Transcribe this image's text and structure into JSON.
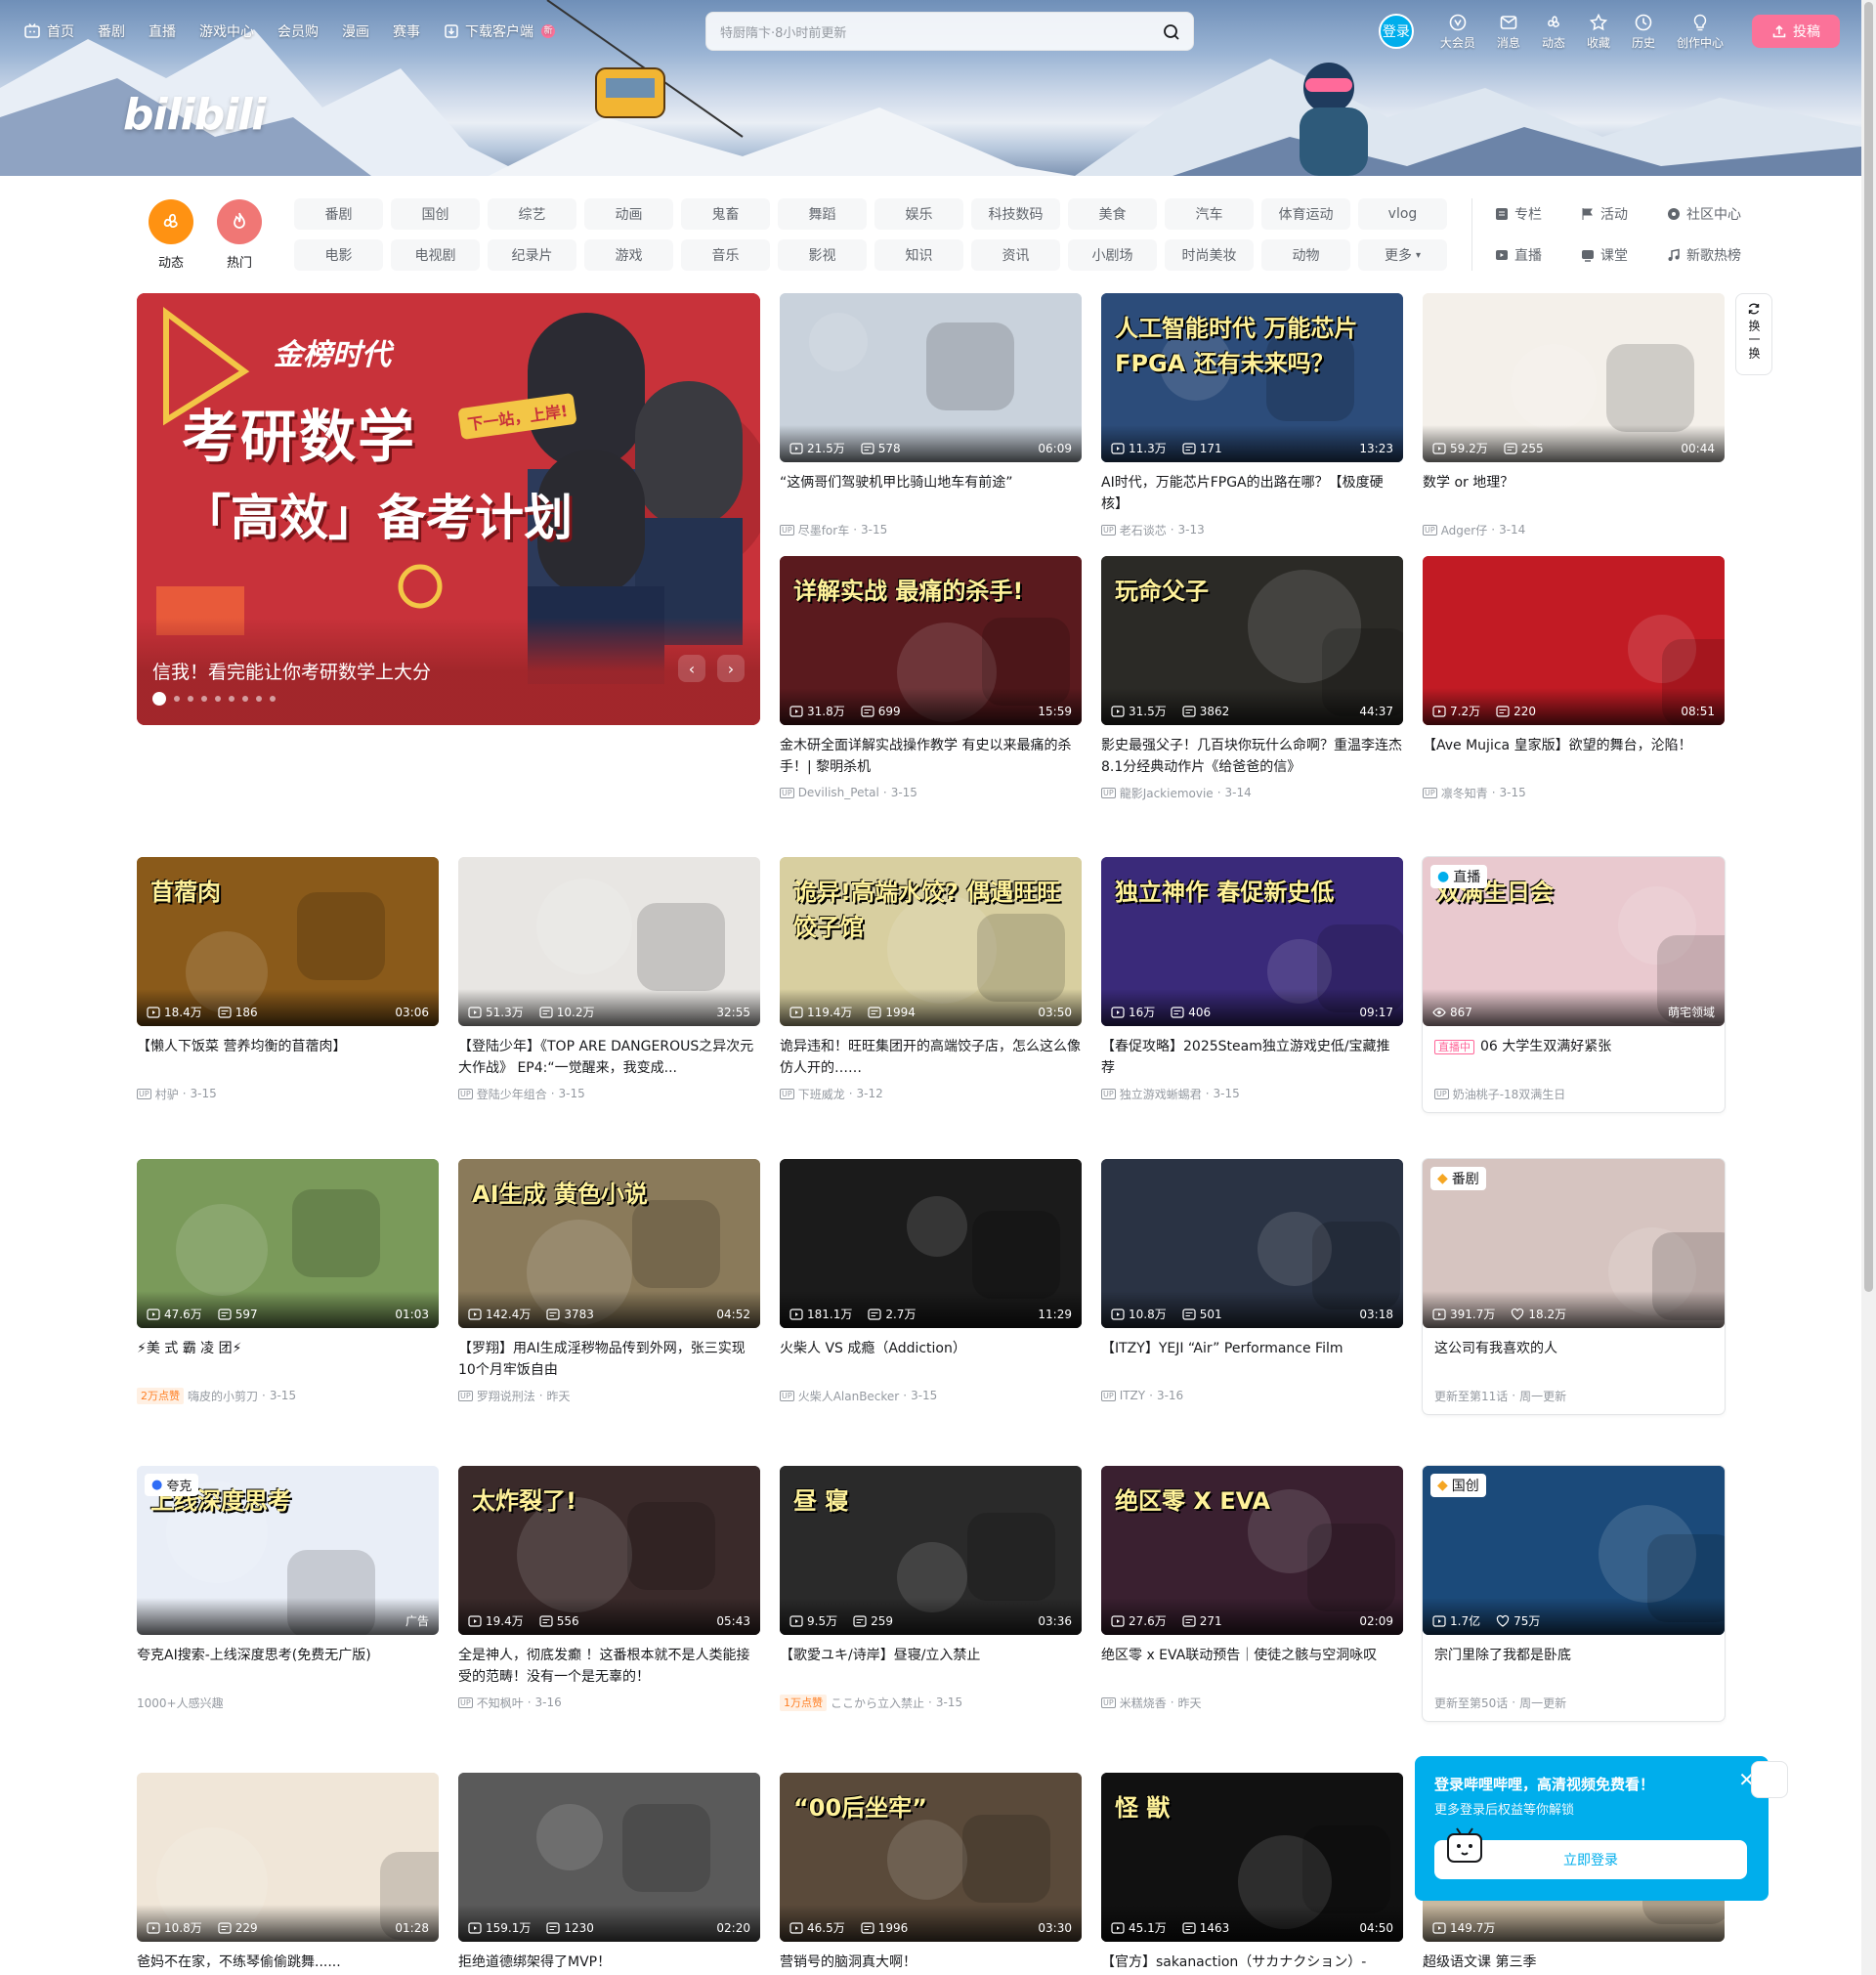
{
  "header": {
    "nav": [
      "首页",
      "番剧",
      "直播",
      "游戏中心",
      "会员购",
      "漫画",
      "赛事",
      "下载客户端"
    ],
    "new_badge": "新",
    "search_placeholder": "特厨隋卞·8小时前更新",
    "login": "登录",
    "right_items": [
      {
        "label": "大会员",
        "icon": "vip-icon"
      },
      {
        "label": "消息",
        "icon": "message-icon"
      },
      {
        "label": "动态",
        "icon": "dynamic-icon"
      },
      {
        "label": "收藏",
        "icon": "favorite-icon"
      },
      {
        "label": "历史",
        "icon": "history-icon"
      },
      {
        "label": "创作中心",
        "icon": "creator-icon"
      }
    ],
    "upload": "投稿",
    "logo": "bilibili"
  },
  "channels": {
    "icons": [
      {
        "label": "动态",
        "color": "#ff9212"
      },
      {
        "label": "热门",
        "color": "#f07775"
      }
    ],
    "tags": [
      "番剧",
      "国创",
      "综艺",
      "动画",
      "鬼畜",
      "舞蹈",
      "娱乐",
      "科技数码",
      "美食",
      "汽车",
      "体育运动",
      "vlog",
      "电影",
      "电视剧",
      "纪录片",
      "游戏",
      "音乐",
      "影视",
      "知识",
      "资讯",
      "小剧场",
      "时尚美妆",
      "动物",
      "更多"
    ],
    "extra": [
      "专栏",
      "活动",
      "社区中心",
      "直播",
      "课堂",
      "新歌热榜"
    ]
  },
  "carousel": {
    "caption": "信我！看完能让你考研数学上大分",
    "banner_brand": "金榜时代",
    "banner_headline1": "考研数学",
    "banner_headline2": "「高效」备考计划",
    "banner_tag": "下一站，上岸!"
  },
  "refresh": {
    "label": "换一换"
  },
  "videos": [
    {
      "title": "“这俩哥们驾驶机甲比骑山地车有前途”",
      "views": "21.5万",
      "danmaku": "578",
      "duration": "06:09",
      "author": "尽墨for车",
      "date": "3-15",
      "bg": "#c9d2dc"
    },
    {
      "title": "AI时代，万能芯片FPGA的出路在哪？【极度硬核】",
      "views": "11.3万",
      "danmaku": "171",
      "duration": "13:23",
      "author": "老石谈芯",
      "date": "3-13",
      "bg": "#2c4c7a",
      "overlay": "人工智能时代 万能芯片FPGA 还有未来吗？"
    },
    {
      "title": "数学 or 地理？",
      "views": "59.2万",
      "danmaku": "255",
      "duration": "00:44",
      "author": "Adger仔",
      "date": "3-14",
      "bg": "#f4f0ea"
    },
    {
      "title": "金木研全面详解实战操作教学 有史以来最痛的杀手！| 黎明杀机",
      "views": "31.8万",
      "danmaku": "699",
      "duration": "15:59",
      "author": "Devilish_Petal",
      "date": "3-15",
      "bg": "#5a1a1e",
      "overlay": "详解实战 最痛的杀手!"
    },
    {
      "title": "影史最强父子！几百块你玩什么命啊？重温李连杰8.1分经典动作片《给爸爸的信》",
      "views": "31.5万",
      "danmaku": "3862",
      "duration": "44:37",
      "author": "龍影Jackiemovie",
      "date": "3-14",
      "bg": "#2b2a26",
      "overlay": "玩命父子"
    },
    {
      "title": "【Ave Mujica 皇家版】欲望的舞台，沦陷！",
      "views": "7.2万",
      "danmaku": "220",
      "duration": "08:51",
      "author": "凛冬知青",
      "date": "3-15",
      "bg": "#c21b24"
    },
    {
      "title": "【懒人下饭菜 营养均衡的苜蓿肉】",
      "views": "18.4万",
      "danmaku": "186",
      "duration": "03:06",
      "author": "村驴",
      "date": "3-15",
      "bg": "#8a5a1a",
      "overlay": "苜蓿肉"
    },
    {
      "title": "【登陆少年】《TOP ARE DANGEROUS之异次元大作战》 EP4:“一觉醒来，我变成...",
      "views": "51.3万",
      "danmaku": "10.2万",
      "duration": "32:55",
      "author": "登陆少年组合",
      "date": "3-15",
      "bg": "#e8e6e3"
    },
    {
      "title": "诡异违和！旺旺集团开的高端饺子店，怎么这么像仿人开的……",
      "views": "119.4万",
      "danmaku": "1994",
      "duration": "03:50",
      "author": "下班威龙",
      "date": "3-12",
      "bg": "#d8cfa0",
      "overlay": "诡异!高端水饺? 偶遇旺旺饺子馆"
    },
    {
      "title": "【春促攻略】2025Steam独立游戏史低/宝藏推荐",
      "views": "16万",
      "danmaku": "406",
      "duration": "09:17",
      "author": "独立游戏蜥蜴君",
      "date": "3-15",
      "bg": "#3a2a7a",
      "overlay": "独立神作 春促新史低"
    },
    {
      "title": "06 大学生双满好紧张",
      "views": "867",
      "danmaku": "",
      "duration": "",
      "author": "奶油桃子-18双满生日",
      "date": "",
      "bg": "#e9c9cf",
      "live": true,
      "live_label": "直播",
      "live_badge": "直播中",
      "area": "萌宅领域",
      "overlay": "双满生日会"
    },
    {
      "title": "⚡美 式 霸 凌 团⚡",
      "views": "47.6万",
      "danmaku": "597",
      "duration": "01:03",
      "author": "嗨皮的小剪刀",
      "date": "3-15",
      "bg": "#7a9a5a",
      "hot": "2万点赞"
    },
    {
      "title": "【罗翔】用AI生成淫秽物品传到外网，张三实现10个月牢饭自由",
      "views": "142.4万",
      "danmaku": "3783",
      "duration": "04:52",
      "author": "罗翔说刑法",
      "date": "昨天",
      "bg": "#8a7a5a",
      "overlay": "AI生成 黄色小说"
    },
    {
      "title": "火柴人 VS 成瘾（Addiction）",
      "views": "181.1万",
      "danmaku": "2.7万",
      "duration": "11:29",
      "author": "火柴人AlanBecker",
      "date": "3-15",
      "bg": "#1b1b1b"
    },
    {
      "title": "【ITZY】YEJI “Air” Performance Film",
      "views": "10.8万",
      "danmaku": "501",
      "duration": "03:18",
      "author": "ITZY",
      "date": "3-16",
      "bg": "#2a3344"
    },
    {
      "title": "这公司有我喜欢的人",
      "views": "391.7万",
      "danmaku": "18.2万",
      "duration": "",
      "author": "更新至第11话",
      "date": "周一更新",
      "bg": "#d6c4c0",
      "badge": "番剧",
      "follow": true
    },
    {
      "title": "夸克AI搜索-上线深度思考(免费无广版)",
      "views": "",
      "danmaku": "",
      "duration": "",
      "author": "1000+人感兴趣",
      "date": "",
      "bg": "#e9eef7",
      "ad": "广告",
      "brand": "夸克",
      "overlay": "上线深度思考"
    },
    {
      "title": "全是神人，彻底发癫 ！这番根本就不是人类能接受的范畴！没有一个是无辜的！",
      "views": "19.4万",
      "danmaku": "556",
      "duration": "05:43",
      "author": "不知枫叶",
      "date": "3-16",
      "bg": "#3a2a2a",
      "overlay": "太炸裂了!"
    },
    {
      "title": "【歌愛ユキ/诗岸】昼寝/立入禁止",
      "views": "9.5万",
      "danmaku": "259",
      "duration": "03:36",
      "author": "ここから立入禁止",
      "date": "3-15",
      "bg": "#2a2a2a",
      "hot": "1万点赞",
      "overlay": "昼 寝"
    },
    {
      "title": "绝区零 x EVA联动预告｜使徒之骸与空洞咏叹",
      "views": "27.6万",
      "danmaku": "271",
      "duration": "02:09",
      "author": "米糕烧香",
      "date": "昨天",
      "bg": "#3a2030",
      "overlay": "绝区零 X EVA"
    },
    {
      "title": "宗门里除了我都是卧底",
      "views": "1.7亿",
      "danmaku": "75万",
      "duration": "",
      "author": "更新至第50话",
      "date": "周一更新",
      "bg": "#1b4a7a",
      "badge": "国创",
      "follow": true
    },
    {
      "title": "爸妈不在家，不练琴偷偷跳舞......",
      "views": "10.8万",
      "danmaku": "229",
      "duration": "01:28",
      "author": "",
      "date": "",
      "bg": "#f0e6d8"
    },
    {
      "title": "拒绝道德绑架得了MVP！",
      "views": "159.1万",
      "danmaku": "1230",
      "duration": "02:20",
      "author": "",
      "date": "",
      "bg": "#5a5a5a"
    },
    {
      "title": "营销号的脑洞真大啊！",
      "views": "46.5万",
      "danmaku": "1996",
      "duration": "03:30",
      "author": "",
      "date": "",
      "bg": "#5a4a3a",
      "overlay": "“00后坐牢”"
    },
    {
      "title": "【官方】sakanaction（サカナクション）-",
      "views": "45.1万",
      "danmaku": "1463",
      "duration": "04:50",
      "author": "",
      "date": "",
      "bg": "#111",
      "overlay": "怪 獣"
    },
    {
      "title": "超级语文课 第三季",
      "views": "149.7万",
      "danmaku": "",
      "duration": "",
      "author": "",
      "date": "",
      "bg": "#c9b9a0"
    }
  ],
  "login_popup": {
    "title": "登录哔哩哔哩，高清视频免费看！",
    "subtitle": "更多登录后权益等你解锁",
    "button": "立即登录"
  }
}
